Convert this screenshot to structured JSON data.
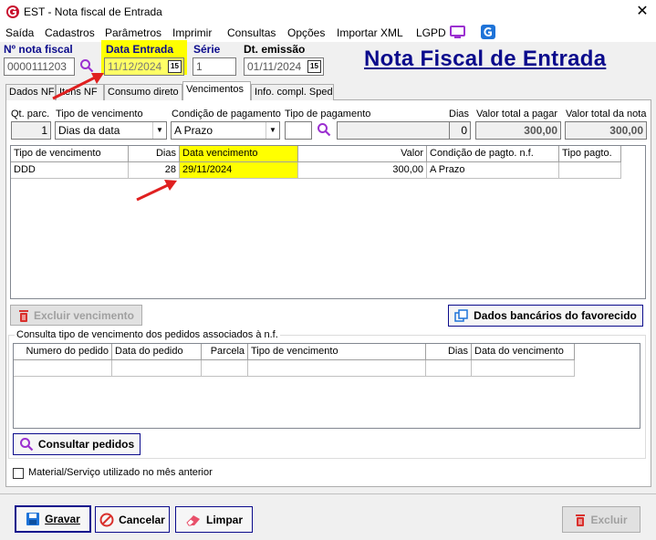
{
  "window": {
    "title": "EST - Nota fiscal de Entrada",
    "close_glyph": "✕"
  },
  "menu": [
    "Saída",
    "Cadastros",
    "Parâmetros",
    "Imprimir",
    "Consultas",
    "Opções",
    "Importar XML",
    "LGPD"
  ],
  "header": {
    "nota_fiscal_label": "Nº nota fiscal",
    "nota_fiscal_value": "0000111203",
    "data_entrada_label": "Data Entrada",
    "data_entrada_value": "11/12/2024",
    "serie_label": "Série",
    "serie_value": "1",
    "dt_emissao_label": "Dt. emissão",
    "dt_emissao_value": "01/11/2024",
    "calendar_glyph": "15",
    "big_title": "Nota Fiscal de Entrada"
  },
  "tabs": [
    "Dados NF",
    "Itens NF",
    "Consumo direto",
    "Vencimentos",
    "Info. compl. Sped"
  ],
  "active_tab": "Vencimentos",
  "form_row": {
    "labels": {
      "qt_parc": "Qt. parc.",
      "tipo_venc": "Tipo de vencimento",
      "cond_pag": "Condição de pagamento",
      "tipo_pag": "Tipo de pagamento",
      "dias": "Dias",
      "valor_total_pagar": "Valor total a pagar",
      "valor_total_nota": "Valor total da nota"
    },
    "values": {
      "qt_parc": "1",
      "tipo_venc": "Dias da data",
      "cond_pag": "A Prazo",
      "tipo_pag": "",
      "dias": "0",
      "valor_total_pagar": "300,00",
      "valor_total_nota": "300,00"
    }
  },
  "venc_grid": {
    "columns": [
      "Tipo de vencimento",
      "Dias",
      "Data vencimento",
      "Valor",
      "Condição de pagto. n.f.",
      "Tipo pagto."
    ],
    "rows": [
      [
        "DDD",
        "28",
        "29/11/2024",
        "300,00",
        "A Prazo",
        ""
      ]
    ]
  },
  "buttons": {
    "excluir_vencimento": "Excluir vencimento",
    "dados_bancarios": "Dados bancários do favorecido",
    "consultar_pedidos": "Consultar pedidos",
    "gravar": "Gravar",
    "cancelar": "Cancelar",
    "limpar": "Limpar",
    "excluir": "Excluir"
  },
  "pedidos_group": {
    "legend": "Consulta tipo de vencimento dos pedidos associados à n.f.",
    "columns": [
      "Numero do pedido",
      "Data do pedido",
      "Parcela",
      "Tipo de vencimento",
      "Dias",
      "Data do vencimento"
    ]
  },
  "checkbox_label": "Material/Serviço utilizado no mês anterior",
  "colors": {
    "highlight": "#ffff00",
    "brand_blue": "#0b0b8c",
    "arrow_red": "#e02020",
    "trash_red": "#d9302c"
  }
}
